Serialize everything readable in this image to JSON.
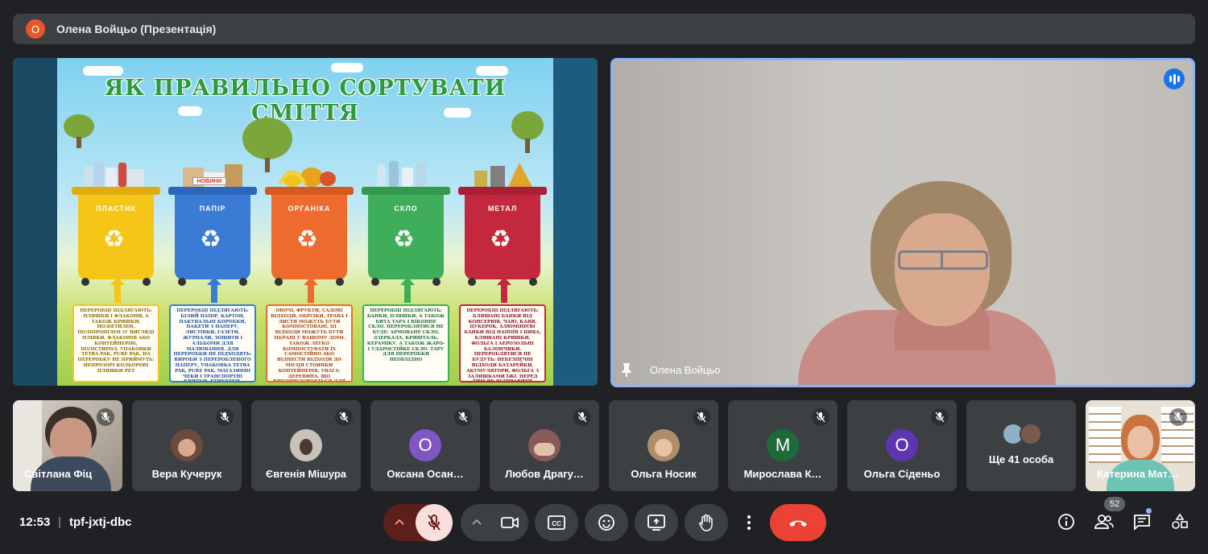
{
  "presentation": {
    "initial": "О",
    "title": "Олена Войцьо (Презентація)"
  },
  "slide": {
    "title": "ЯК ПРАВИЛЬНО СОРТУВАТИ СМІТТЯ",
    "news_label": "НОВИНИ",
    "bins": [
      {
        "label": "ПЛАСТИК",
        "color": "#f5c518",
        "text": "ПЕРЕРОБЦІ ПІДЛЯГАЮТЬ: ПЛЯШКИ І ФЛАКОНИ, А ТАКОЖ КРИШКИ, ПОЛІЕТИЛЕН, ПОЛІПРОПІЛЕН (У ВИГЛЯДІ ПЛІВКИ, ФЛАКОНІВ АБО КОНТЕЙНЕРІВ), ПОЛІСТИРОЛ, УПАКОВКИ TETRA PAK, PURE PAK. НА ПЕРЕРОБКУ НЕ ПРИЙМУТЬ: НЕПРОЗОРІ КОЛЬОРОВІ ПЛЯШКИ PET"
      },
      {
        "label": "ПАПІР",
        "color": "#3a7bd5",
        "text": "ПЕРЕРОБЦІ ПІДЛЯГАЮТЬ: БІЛИЙ ПАПІР, КАРТОН, ПАКУВАЛЬНІ КОРОБКИ, ПАКЕТИ З ПАПЕРУ, ЛИСТІВКИ, ГАЗЕТИ, ЖУРНАЛИ, ЗОШИТИ І АЛЬБОМИ ДЛЯ МАЛЮВАННЯ. ДЛЯ ПЕРЕРОБКИ НЕ ПІДХОДЯТЬ: ВИРОБИ З ПЕРЕРОБЛЕНОГО ПАПЕРУ, УПАКОВКА TETRA PAK, PURE PAK, МАГАЗИННІ ЧЕКИ І ТРАНСПОРТНІ КВИТКИ, ЕТИКЕТКИ. ТАКОЖ ЛАМІНОВАНИЙ І ГОСПОДАРСЬКИЙ ПАПІР. НА ПЕРЕРОБКУ ВІЗЬМУТЬ СУХІ І ЧИСТІ ПАПЕРОВІ ВІДХОДИ."
      },
      {
        "label": "ОРГАНІКА",
        "color": "#ec6b2d",
        "text": "ОВОЧІ, ФРУКТИ, САДОВІ ВІДХОДИ, ОБРІЗКИ, ТРАВА І ЛИСТЯ МОЖУТЬ БУТИ КОМПОСТОВАНІ. ЦІ ВІДХОДИ МОЖУТЬ БУТИ ЗІБРАНІ У ВАШОМУ ДОМІ. ТАКОЖ ЛЕГКО КОМПОСТУВАТИ ЇХ САМОСТІЙНО АБО ВІДНЕСТИ ВІДХОДИ ДО МІСЦЯ СТОЯНКИ КОНТЕЙНЕРІВ. УВАГА: ДЕРЕВИНА, ЩО ВИКОРИСТОВУЄТЬСЯ ДЛЯ БУДІВНИЦТВА, ДЕРЕВНЕ ВУГІЛЛЯ ТА МУШЛІ МІДІЙ НЕ ПРИДАТНІ ДЛЯ КОМПОСТУВАННЯ."
      },
      {
        "label": "СКЛО",
        "color": "#3fae5a",
        "text": "ПЕРЕРОБЦІ ПІДЛЯГАЮТЬ: БАНКИ, ПЛЯШКИ, А ТАКОЖ БИТА ТАРА І ВІКОННЕ СКЛО. ПЕРЕРОБЛЯТИСЯ НЕ БУДЕ: АРМОВАНЕ СКЛО, ДЗЕРКАЛА, КРИШТАЛЬ, КЕРАМІКУ, А ТАКОЖ ЖАРО- І УДАРОСТІЙКЕ СКЛО. ТАРУ ДЛЯ ПЕРЕРОБКИ НЕОБХІДНО"
      },
      {
        "label": "МЕТАЛ",
        "color": "#c4283e",
        "text": "ПЕРЕРОБЦІ ПІДЛЯГАЮТЬ: БЛЯШАНІ БАНКИ ВІД КОНСЕРВІВ, ЧАЮ, КАВИ, ЦУКЕРОК, АЛЮМІНІЄВІ БАНКИ ВІД НАПОЇВ І ПИВА, БЛЯШАНІ КРИШКИ, ФОЛЬГА І АЕРОЗОЛЬНІ БАЛОНЧИКИ. ПЕРЕРОБЛЯТИСЯ НЕ БУДУТЬ: НЕБЕЗПЕЧНІ ВІДХОДИ БАТАРЕЙКИ, АКУМУЛЯТОРИ, ФОЛЬГА З ЗАЛИШКАМИ ЇЖІ. ПЕРЕД ТИМ ЯК ВІДПРАВИТИ АЛЮМІНІЄВІ І БЛЯШАНІ БАНКИ В СМІТТЄВИЙ КОНТЕЙНЕР, ЇХ НЕОБХІДНО ВИМИТИ, ВИСУШИТИ І ПО МОЖЛИВОСТІ ЗІМ'ЯТИ."
      }
    ]
  },
  "camera": {
    "name": "Олена Войцьо"
  },
  "participants": [
    {
      "name": "Світлана Фіц",
      "type": "video"
    },
    {
      "name": "Вера Кучерук",
      "type": "photo",
      "avatar_color": "#6b4b3e"
    },
    {
      "name": "Євгенія Мішура",
      "type": "photo",
      "avatar_color": "#c9c2b8"
    },
    {
      "name": "Оксана Осан…",
      "type": "letter",
      "letter": "О",
      "avatar_color": "#7e57c2"
    },
    {
      "name": "Любов Драгу…",
      "type": "photo",
      "avatar_color": "#8a5a5a"
    },
    {
      "name": "Ольга Носик",
      "type": "photo",
      "avatar_color": "#b08d6a"
    },
    {
      "name": "Мирослава К…",
      "type": "letter",
      "letter": "М",
      "avatar_color": "#1e6b3a"
    },
    {
      "name": "Ольга Сіденьо",
      "type": "letter",
      "letter": "О",
      "avatar_color": "#5e35b1"
    },
    {
      "name": "Ще 41 особа",
      "type": "more"
    },
    {
      "name": "Катерина Мат…",
      "type": "video"
    }
  ],
  "meeting": {
    "time": "12:53",
    "separator": "|",
    "code": "tpf-jxtj-dbc",
    "people_count": "52"
  },
  "colors": {
    "accent": "#8ab4f8",
    "end_call": "#ea4335",
    "mic_off_bg": "#f9dedc"
  }
}
